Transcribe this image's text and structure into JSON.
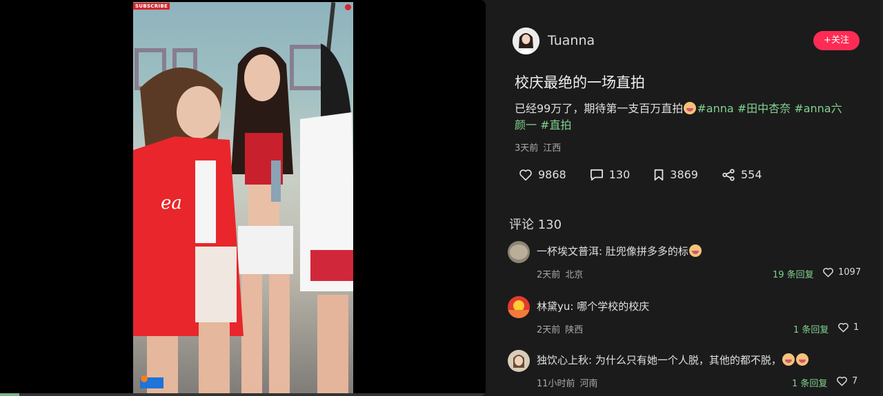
{
  "video": {
    "subscribe_badge": "SUBSCRIBE",
    "progress_fraction": 0.04
  },
  "author": {
    "name": "Tuanna",
    "follow_label": "+关注"
  },
  "post": {
    "title": "校庆最绝的一场直拍",
    "desc_text": "已经99万了，期待第一支百万直拍",
    "hashtags": [
      "#anna",
      "#田中杏奈",
      "#anna六颜一",
      "#直拍"
    ],
    "time": "3天前",
    "location": "江西"
  },
  "actions": {
    "likes": "9868",
    "comments": "130",
    "favorites": "3869",
    "shares": "554"
  },
  "comments_section": {
    "heading": "评论 130",
    "items": [
      {
        "author": "一杯埃文普洱",
        "text": "肚兜像拼多多的标",
        "time": "2天前",
        "location": "北京",
        "replies": "19 条回复",
        "likes": "1097"
      },
      {
        "author": "林黛yu",
        "text": "哪个学校的校庆",
        "time": "2天前",
        "location": "陕西",
        "replies": "1 条回复",
        "likes": "1"
      },
      {
        "author": "独饮心上秋",
        "text": "为什么只有她一个人脱，其他的都不脱，",
        "time": "11小时前",
        "location": "河南",
        "replies": "1 条回复",
        "likes": "7"
      }
    ]
  },
  "colors": {
    "accent": "#fe2c55",
    "hashtag": "#80d28f",
    "background": "#1b1b1b"
  }
}
